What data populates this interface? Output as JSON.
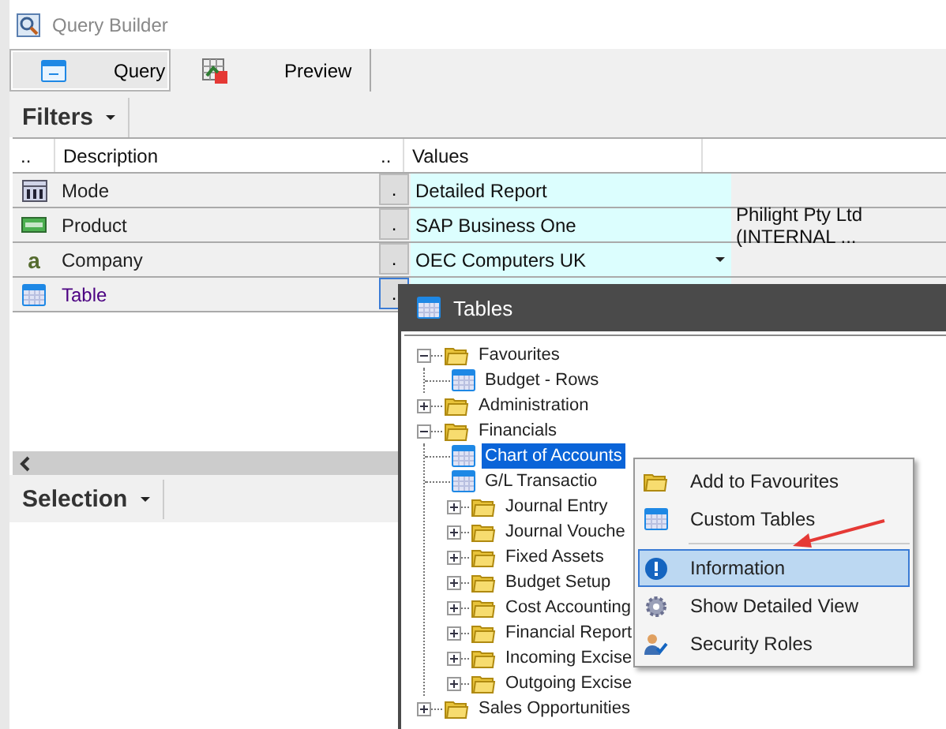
{
  "window": {
    "title": "Query Builder"
  },
  "tabs": [
    {
      "label": "Query",
      "selected": true
    },
    {
      "label": "Preview",
      "selected": false
    }
  ],
  "filters": {
    "title": "Filters",
    "columns": [
      "..",
      "Description",
      "..",
      "Values"
    ],
    "rows": [
      {
        "kind": "mode",
        "description": "Mode",
        "button": ".",
        "value": "Detailed Report",
        "focused": false,
        "dropdown": false
      },
      {
        "kind": "product",
        "description": "Product",
        "button": ".",
        "value": "SAP Business One",
        "column_5": "Philight Pty Ltd (INTERNAL ...",
        "focused": false,
        "dropdown": false
      },
      {
        "kind": "company",
        "icon_text": "a",
        "description": "Company",
        "button": ".",
        "value": "OEC Computers UK",
        "focused": false,
        "dropdown": true
      },
      {
        "kind": "table",
        "description": "Table",
        "button": ".",
        "focused": true,
        "dropdown": false
      }
    ]
  },
  "selection": {
    "title": "Selection"
  },
  "tables_dialog": {
    "title": "Tables",
    "tree": [
      {
        "kind": "folder",
        "label": "Favourites",
        "expanded": true,
        "selected": false,
        "children": [
          {
            "kind": "table",
            "label": "Budget - Rows",
            "selected": false
          }
        ]
      },
      {
        "kind": "folder",
        "label": "Administration",
        "expanded": false,
        "selected": false
      },
      {
        "kind": "folder",
        "label": "Financials",
        "expanded": true,
        "selected": false,
        "children": [
          {
            "kind": "table",
            "label": "Chart of Accounts",
            "selected": true
          },
          {
            "kind": "table",
            "label": "G/L Transactio",
            "selected": false
          },
          {
            "kind": "folder",
            "label": "Journal Entry",
            "expanded": false,
            "selected": false
          },
          {
            "kind": "folder",
            "label": "Journal Vouche",
            "expanded": false,
            "selected": false
          },
          {
            "kind": "folder",
            "label": "Fixed Assets",
            "expanded": false,
            "selected": false
          },
          {
            "kind": "folder",
            "label": "Budget Setup",
            "expanded": false,
            "selected": false
          },
          {
            "kind": "folder",
            "label": "Cost Accounting",
            "expanded": false,
            "selected": false
          },
          {
            "kind": "folder",
            "label": "Financial Report",
            "expanded": false,
            "selected": false
          },
          {
            "kind": "folder",
            "label": "Incoming Excise",
            "expanded": false,
            "selected": false
          },
          {
            "kind": "folder",
            "label": "Outgoing Excise",
            "expanded": false,
            "selected": false
          }
        ]
      },
      {
        "kind": "folder",
        "label": "Sales Opportunities",
        "expanded": false,
        "selected": false
      }
    ]
  },
  "context_menu": {
    "items": [
      {
        "kind": "folder",
        "label": "Add to Favourites",
        "selected": false
      },
      {
        "kind": "table",
        "label": "Custom Tables",
        "selected": false
      },
      {
        "kind": "separator"
      },
      {
        "kind": "info",
        "label": "Information",
        "selected": true
      },
      {
        "kind": "gear",
        "label": "Show Detailed View",
        "selected": false
      },
      {
        "kind": "user",
        "label": "Security Roles",
        "selected": false
      }
    ]
  }
}
